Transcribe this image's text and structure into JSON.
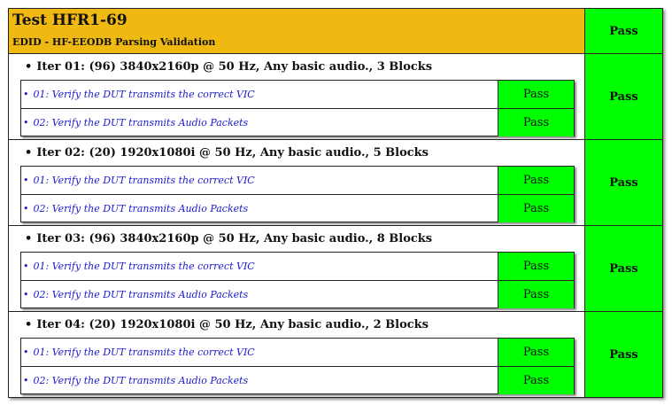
{
  "test": {
    "title": "Test HFR1-69",
    "subtitle": "EDID - HF-EEODB Parsing Validation",
    "result": "Pass",
    "header_color": "#f0b911",
    "pass_color": "#00ff00"
  },
  "iterations": [
    {
      "title": "Iter 01: (96) 3840x2160p @ 50 Hz, Any basic audio., 3 Blocks",
      "result": "Pass",
      "checks": [
        {
          "label": "01: Verify the DUT transmits the correct VIC",
          "result": "Pass"
        },
        {
          "label": "02: Verify the DUT transmits Audio Packets",
          "result": "Pass"
        }
      ]
    },
    {
      "title": "Iter 02: (20) 1920x1080i @ 50 Hz, Any basic audio., 5 Blocks",
      "result": "Pass",
      "checks": [
        {
          "label": "01: Verify the DUT transmits the correct VIC",
          "result": "Pass"
        },
        {
          "label": "02: Verify the DUT transmits Audio Packets",
          "result": "Pass"
        }
      ]
    },
    {
      "title": "Iter 03: (96) 3840x2160p @ 50 Hz, Any basic audio., 8 Blocks",
      "result": "Pass",
      "checks": [
        {
          "label": "01: Verify the DUT transmits the correct VIC",
          "result": "Pass"
        },
        {
          "label": "02: Verify the DUT transmits Audio Packets",
          "result": "Pass"
        }
      ]
    },
    {
      "title": "Iter 04: (20) 1920x1080i @ 50 Hz, Any basic audio., 2 Blocks",
      "result": "Pass",
      "checks": [
        {
          "label": "01: Verify the DUT transmits the correct VIC",
          "result": "Pass"
        },
        {
          "label": "02: Verify the DUT transmits Audio Packets",
          "result": "Pass"
        }
      ]
    }
  ]
}
